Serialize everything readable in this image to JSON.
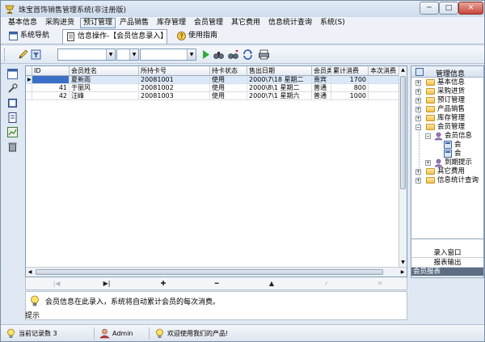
{
  "window": {
    "title": "珠宝首饰销售管理系统(非注册版)",
    "min_label": "─",
    "max_label": "□",
    "close_label": "✕"
  },
  "menu": [
    "基本信息",
    "采购进货",
    "预订管理",
    "产品销售",
    "库存管理",
    "会员管理",
    "其它费用",
    "信息统计查询",
    "系统(S)"
  ],
  "menu_active_index": 2,
  "tabs": {
    "nav": "系统导航",
    "info_op": "信息操作-【会员信息录入】",
    "guide": "使用指南"
  },
  "grid": {
    "columns": [
      "ID",
      "会员姓名",
      "所持卡号",
      "持卡状态",
      "售出日期",
      "会员类",
      "累计消费",
      "本次消费"
    ],
    "rows": [
      {
        "id": "",
        "name": "夏新雨",
        "card": "20081001",
        "status": "使用",
        "date": "2000\\7\\18 星期二",
        "type": "贵宾",
        "total": "1700",
        "current": ""
      },
      {
        "id": "41",
        "name": "于丽风",
        "card": "20081002",
        "status": "使用",
        "date": "2000\\8\\1 星期二",
        "type": "普通",
        "total": "800",
        "current": ""
      },
      {
        "id": "42",
        "name": "汪峰",
        "card": "20081003",
        "status": "使用",
        "date": "2000\\7\\1 星期六",
        "type": "普通",
        "total": "1000",
        "current": ""
      }
    ],
    "current_marker": "▶",
    "row_pointer": "*"
  },
  "navigator": {
    "first": "|◀",
    "last": "▶|",
    "insert": "✚",
    "delete": "━",
    "edit": "▲",
    "post": "✓",
    "cancel": "✕"
  },
  "hint": {
    "text": "会员信息在此录入，系统将自动累计会员的每次消费。",
    "label": "提示"
  },
  "tree": {
    "header": "管理信息",
    "nodes": [
      {
        "label": "基本信息",
        "level": 0,
        "expander": "+"
      },
      {
        "label": "采购进货",
        "level": 0,
        "expander": "+"
      },
      {
        "label": "预订管理",
        "level": 0,
        "expander": "+"
      },
      {
        "label": "产品销售",
        "level": 0,
        "expander": "+"
      },
      {
        "label": "库存管理",
        "level": 0,
        "expander": "+"
      },
      {
        "label": "会员管理",
        "level": 0,
        "expander": "−"
      },
      {
        "label": "会员信息",
        "level": 1,
        "expander": "−"
      },
      {
        "label": "会",
        "level": 2,
        "expander": ""
      },
      {
        "label": "会",
        "level": 2,
        "expander": ""
      },
      {
        "label": "到期提示",
        "level": 1,
        "expander": "+"
      },
      {
        "label": "其它费用",
        "level": 0,
        "expander": "+"
      },
      {
        "label": "信息统计查询",
        "level": 0,
        "expander": "+"
      }
    ]
  },
  "right_buttons": [
    "录入窗口",
    "报表输出",
    "会员报表"
  ],
  "right_selected_index": 2,
  "status": {
    "records": "当前记录数 3",
    "user": "Admin",
    "welcome": "欢迎使用我们的产品!"
  },
  "icons": [
    "app-icon",
    "pencil-icon",
    "binoculars-icon",
    "refresh-icon",
    "print-icon",
    "help-icon",
    "lightbulb-icon",
    "user-icon",
    "folder-icon"
  ],
  "colors": {
    "selected_row": "#dbe8fa",
    "current_cell": "#3a6fc7",
    "titlebar": "#cddbeb",
    "close_button": "#c7463a"
  }
}
